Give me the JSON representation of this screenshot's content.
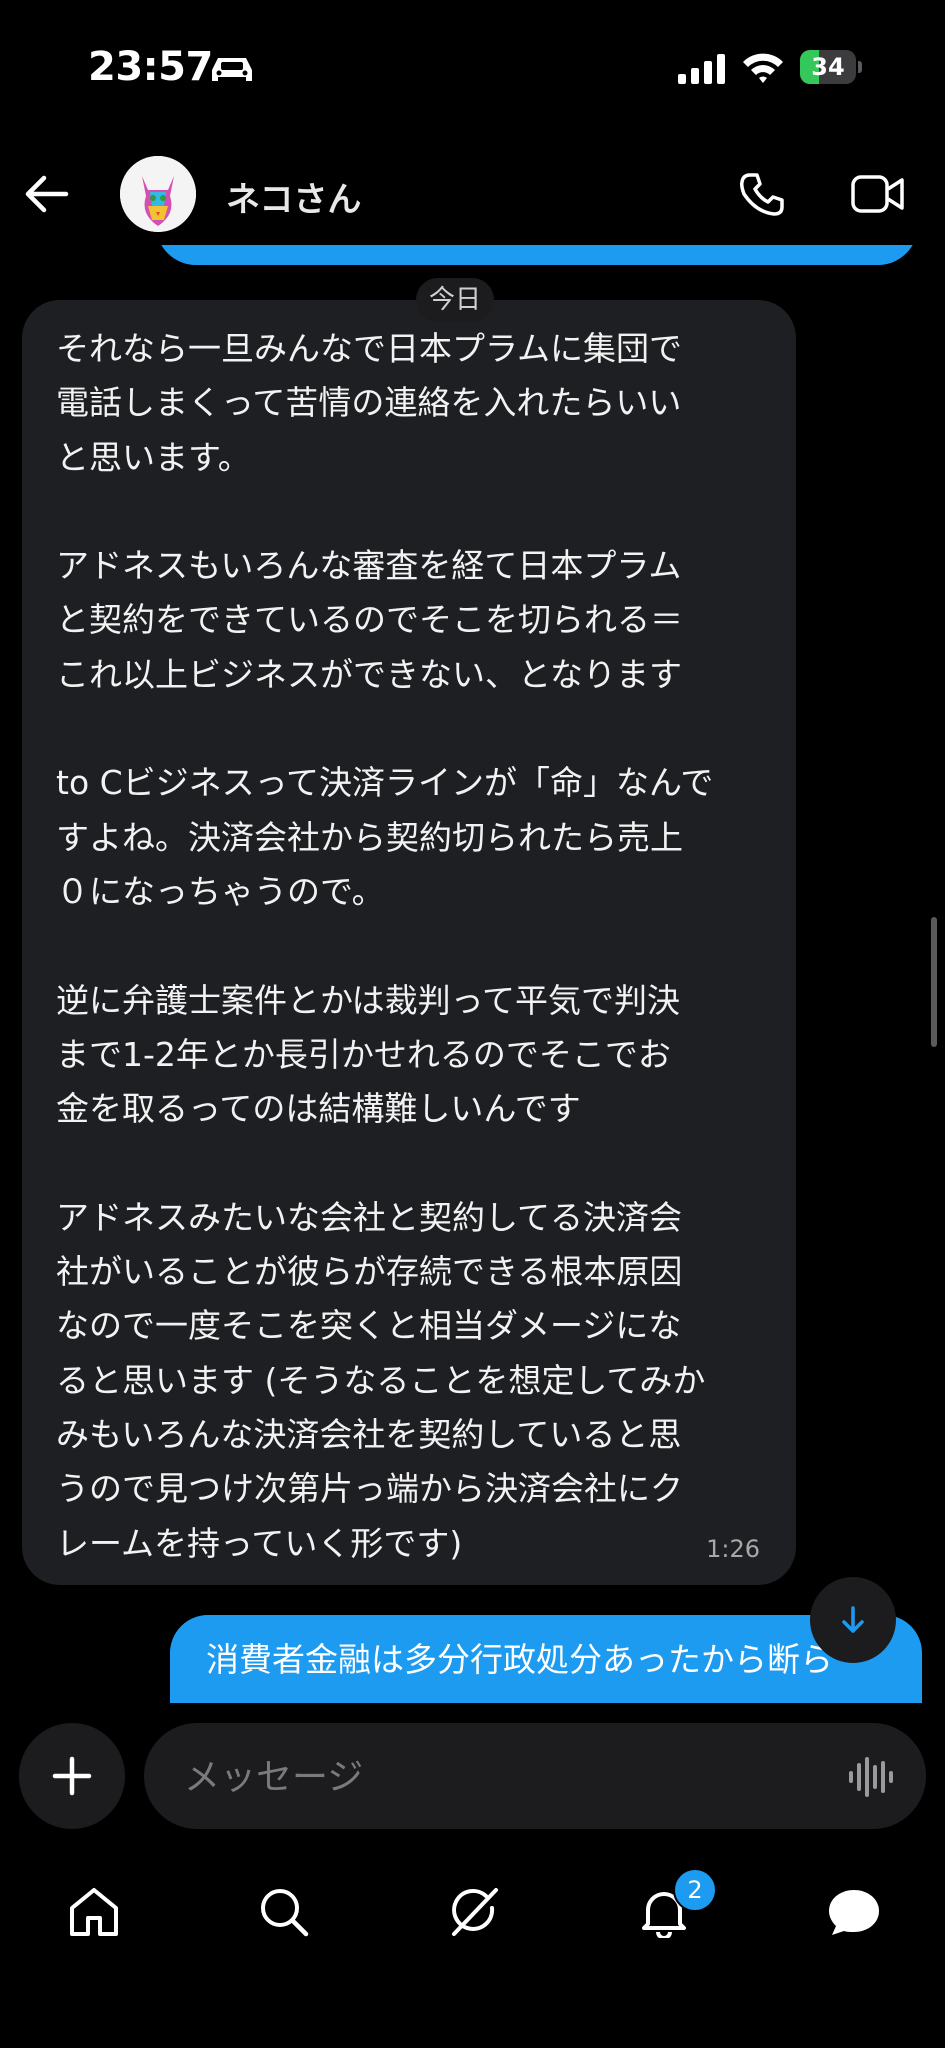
{
  "status_bar": {
    "time": "23:57",
    "battery": "34",
    "battery_level": 0.34,
    "icons": [
      "car-icon",
      "signal-icon",
      "wifi-icon",
      "battery-icon"
    ]
  },
  "header": {
    "contact_name": "ネコさん",
    "icons": [
      "back-arrow-icon",
      "phone-icon",
      "video-call-icon"
    ]
  },
  "chat": {
    "date_divider": "今日",
    "incoming_message": {
      "text": "それなら一旦みんなで日本プラムに集団で\n電話しまくって苦情の連絡を入れたらいい\nと思います。\n\nアドネスもいろんな審査を経て日本プラム\nと契約をできているのでそこを切られる＝\nこれ以上ビジネスができない、となります\n\nto Cビジネスって決済ラインが「命」なんで\nすよね。決済会社から契約切られたら売上\n０になっちゃうので。\n\n逆に弁護士案件とかは裁判って平気で判決\nまで1-2年とか長引かせれるのでそこでお\n金を取るってのは結構難しいんです\n\nアドネスみたいな会社と契約してる決済会\n社がいることが彼らが存続できる根本原因\nなので一度そこを突くと相当ダメージにな\nると思います (そうなることを想定してみか\nみもいろんな決済会社を契約していると思\nうので見つけ次第片っ端から決済会社にク\nレームを持っていく形です)",
      "time": "1:26"
    },
    "outgoing_message": {
      "text": "消費者金融は多分行政処分あったから断ら"
    }
  },
  "composer": {
    "placeholder": "メッセージ",
    "icons": [
      "plus-icon",
      "voice-icon"
    ]
  },
  "tab_bar": {
    "notification_count": "2",
    "icons": [
      "home-icon",
      "search-icon",
      "grok-icon",
      "bell-icon",
      "messages-icon"
    ]
  },
  "colors": {
    "accent": "#1d9bf0",
    "bubble_incoming": "#1e1f22",
    "background": "#000000",
    "battery_green": "#34c759"
  }
}
